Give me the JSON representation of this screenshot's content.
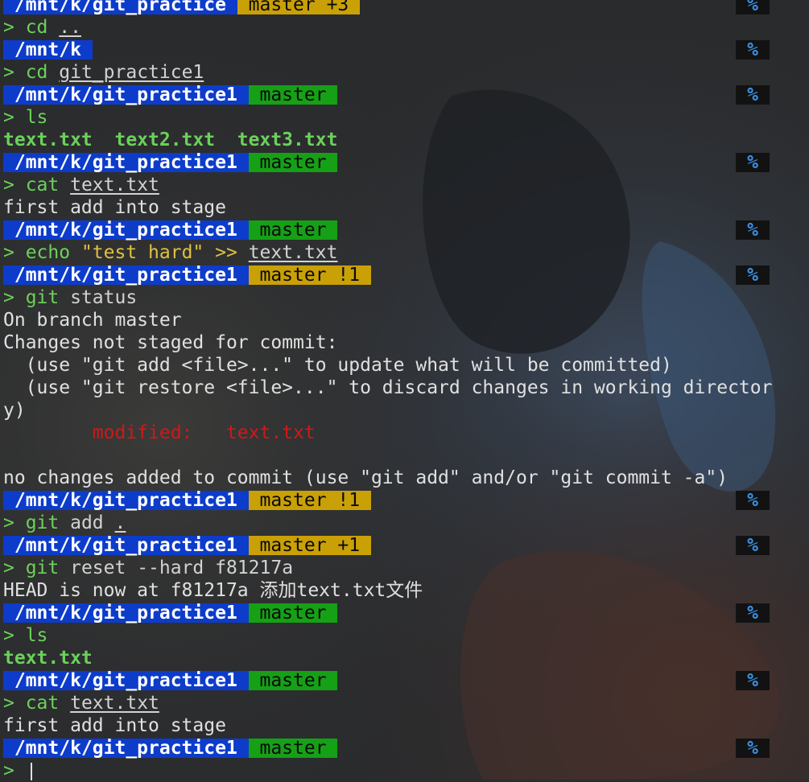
{
  "prompt_symbol": ">",
  "percent": "%",
  "colors": {
    "path_bg": "#0d3ccb",
    "branch_clean_bg": "#16a016",
    "branch_dirty_bg": "#c9a006",
    "command": "#6ad25a",
    "string": "#e0c040",
    "modified": "#d01818",
    "percent": "#3a8fe0"
  },
  "blocks": [
    {
      "prompt": {
        "path": "/mnt/k/git_practice",
        "branch": "master +3",
        "state": "dirty"
      },
      "command": [
        {
          "t": "cd",
          "c": "cmd"
        },
        {
          "t": " "
        },
        {
          "t": "..",
          "c": "argu"
        }
      ],
      "output": []
    },
    {
      "prompt": {
        "path": "/mnt/k",
        "branch": "",
        "state": "none"
      },
      "command": [
        {
          "t": "cd",
          "c": "cmd"
        },
        {
          "t": " "
        },
        {
          "t": "git_practice1",
          "c": "argu"
        }
      ],
      "output": []
    },
    {
      "prompt": {
        "path": "/mnt/k/git_practice1",
        "branch": "master",
        "state": "clean"
      },
      "command": [
        {
          "t": "ls",
          "c": "cmd"
        }
      ],
      "output": [
        [
          {
            "t": "text.txt  text2.txt  text3.txt",
            "c": "file"
          }
        ]
      ]
    },
    {
      "prompt": {
        "path": "/mnt/k/git_practice1",
        "branch": "master",
        "state": "clean"
      },
      "command": [
        {
          "t": "cat",
          "c": "cmd"
        },
        {
          "t": " "
        },
        {
          "t": "text.txt",
          "c": "argu"
        }
      ],
      "output": [
        [
          {
            "t": "first add into stage",
            "c": "out"
          }
        ]
      ]
    },
    {
      "prompt": {
        "path": "/mnt/k/git_practice1",
        "branch": "master",
        "state": "clean"
      },
      "command": [
        {
          "t": "echo",
          "c": "cmd"
        },
        {
          "t": " "
        },
        {
          "t": "\"test hard\"",
          "c": "str"
        },
        {
          "t": " "
        },
        {
          "t": ">>",
          "c": "str"
        },
        {
          "t": " "
        },
        {
          "t": "text.txt",
          "c": "argu"
        }
      ],
      "output": []
    },
    {
      "prompt": {
        "path": "/mnt/k/git_practice1",
        "branch": "master !1",
        "state": "dirty"
      },
      "command": [
        {
          "t": "git",
          "c": "cmd"
        },
        {
          "t": " "
        },
        {
          "t": "status",
          "c": "arg"
        }
      ],
      "output": [
        [
          {
            "t": "On branch master",
            "c": "out"
          }
        ],
        [
          {
            "t": "Changes not staged for commit:",
            "c": "out"
          }
        ],
        [
          {
            "t": "  (use \"git add <file>...\" to update what will be committed)",
            "c": "out"
          }
        ],
        [
          {
            "t": "  (use \"git restore <file>...\" to discard changes in working director",
            "c": "out"
          }
        ],
        [
          {
            "t": "y)",
            "c": "out"
          }
        ],
        [
          {
            "t": "        modified:   text.txt",
            "c": "mod"
          }
        ],
        [
          {
            "t": "",
            "c": "out"
          }
        ],
        [
          {
            "t": "no changes added to commit (use \"git add\" and/or \"git commit -a\")",
            "c": "out"
          }
        ]
      ]
    },
    {
      "prompt": {
        "path": "/mnt/k/git_practice1",
        "branch": "master !1",
        "state": "dirty"
      },
      "command": [
        {
          "t": "git",
          "c": "cmd"
        },
        {
          "t": " "
        },
        {
          "t": "add",
          "c": "arg"
        },
        {
          "t": " "
        },
        {
          "t": ".",
          "c": "argu"
        }
      ],
      "output": []
    },
    {
      "prompt": {
        "path": "/mnt/k/git_practice1",
        "branch": "master +1",
        "state": "dirty"
      },
      "command": [
        {
          "t": "git",
          "c": "cmd"
        },
        {
          "t": " "
        },
        {
          "t": "reset --hard f81217a",
          "c": "arg"
        }
      ],
      "output": [
        [
          {
            "t": "HEAD is now at f81217a 添加text.txt文件",
            "c": "out"
          }
        ]
      ]
    },
    {
      "prompt": {
        "path": "/mnt/k/git_practice1",
        "branch": "master",
        "state": "clean"
      },
      "command": [
        {
          "t": "ls",
          "c": "cmd"
        }
      ],
      "output": [
        [
          {
            "t": "text.txt",
            "c": "file"
          }
        ]
      ]
    },
    {
      "prompt": {
        "path": "/mnt/k/git_practice1",
        "branch": "master",
        "state": "clean"
      },
      "command": [
        {
          "t": "cat",
          "c": "cmd"
        },
        {
          "t": " "
        },
        {
          "t": "text.txt",
          "c": "argu"
        }
      ],
      "output": [
        [
          {
            "t": "first add into stage",
            "c": "out"
          }
        ]
      ]
    },
    {
      "prompt": {
        "path": "/mnt/k/git_practice1",
        "branch": "master",
        "state": "clean"
      },
      "command": [],
      "output": [],
      "active": true
    }
  ]
}
